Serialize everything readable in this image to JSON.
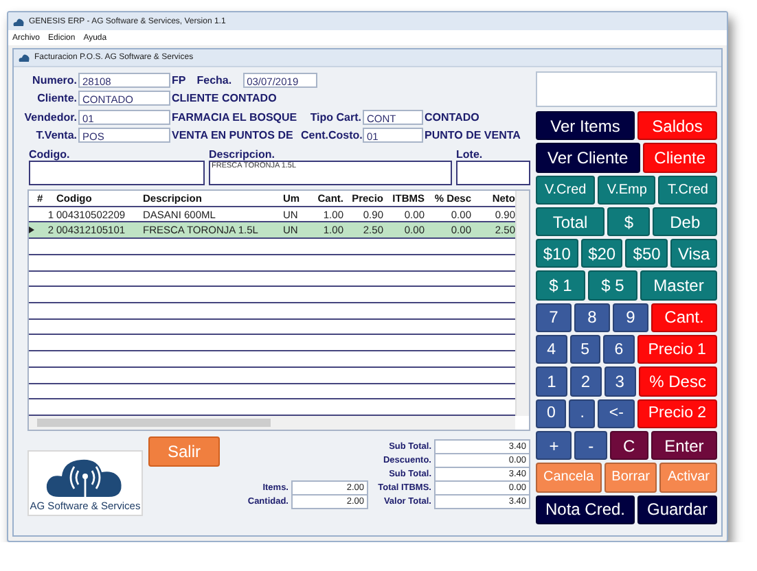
{
  "window": {
    "title": "GENESIS ERP - AG Software & Services, Version 1.1"
  },
  "menu": [
    "Archivo",
    "Edicion",
    "Ayuda"
  ],
  "form_window": {
    "title": "Facturacion P.O.S. AG Software & Services"
  },
  "numero": {
    "label": "Numero.",
    "value": "28108"
  },
  "doc_type": "FP",
  "fecha": {
    "label": "Fecha.",
    "value": "03/07/2019"
  },
  "cliente": {
    "label": "Cliente.",
    "value": "CONTADO",
    "name": "CLIENTE CONTADO"
  },
  "vendedor": {
    "label": "Vendedor.",
    "value": "01",
    "name": "FARMACIA EL BOSQUE"
  },
  "tipo_cart": {
    "label": "Tipo Cart.",
    "value": "CONT",
    "name": "CONTADO"
  },
  "t_venta": {
    "label": "T.Venta.",
    "value": "POS",
    "name": "VENTA EN PUNTOS DE"
  },
  "cent_costo": {
    "label": "Cent.Costo.",
    "value": "01",
    "name": "PUNTO DE VENTA"
  },
  "entry": {
    "codigo": {
      "label": "Codigo."
    },
    "descripcion": {
      "label": "Descripcion.",
      "value": "FRESCA TORONJA 1.5L"
    },
    "lote": {
      "label": "Lote."
    }
  },
  "table": {
    "columns": [
      "#",
      "Codigo",
      "Descripcion",
      "Um",
      "Cant.",
      "Precio",
      "ITBMS",
      "% Desc",
      "Neto"
    ],
    "rows": [
      {
        "selected": false,
        "cells": [
          "1",
          "004310502209",
          "DASANI 600ML",
          "UN",
          "1.00",
          "0.90",
          "0.00",
          "0.00",
          "0.90"
        ]
      },
      {
        "selected": true,
        "cells": [
          "2",
          "004312105101",
          "FRESCA TORONJA 1.5L",
          "UN",
          "1.00",
          "2.50",
          "0.00",
          "0.00",
          "2.50"
        ]
      }
    ]
  },
  "logo": {
    "text": "AG Software & Services"
  },
  "exit_button": "Salir",
  "totals": [
    {
      "label": "Sub Total.",
      "value": "3.40"
    },
    {
      "label": "Descuento.",
      "value": "0.00"
    },
    {
      "label": "Sub Total.",
      "value": "3.40"
    },
    {
      "label": "Total ITBMS.",
      "value": "0.00"
    },
    {
      "label": "Valor Total.",
      "value": "3.40"
    }
  ],
  "counts": [
    {
      "label": "Items.",
      "value": "2.00"
    },
    {
      "label": "Cantidad.",
      "value": "2.00"
    }
  ],
  "keypad": [
    [
      {
        "label": "Ver Items",
        "kind": "navy"
      },
      {
        "label": "Saldos",
        "kind": "red"
      }
    ],
    [
      {
        "label": "Ver Cliente",
        "kind": "navy"
      },
      {
        "label": "Cliente",
        "kind": "red"
      }
    ],
    [
      {
        "label": "V.Cred",
        "kind": "teal"
      },
      {
        "label": "V.Emp",
        "kind": "teal"
      },
      {
        "label": "T.Cred",
        "kind": "teal"
      }
    ],
    [
      {
        "label": "Total",
        "kind": "teal"
      },
      {
        "label": "$",
        "kind": "teal"
      },
      {
        "label": "Deb",
        "kind": "teal"
      }
    ],
    [
      {
        "label": "$10",
        "kind": "teal"
      },
      {
        "label": "$20",
        "kind": "teal"
      },
      {
        "label": "$50",
        "kind": "teal"
      },
      {
        "label": "Visa",
        "kind": "teal"
      }
    ],
    [
      {
        "label": "$ 1",
        "kind": "teal"
      },
      {
        "label": "$ 5",
        "kind": "teal"
      },
      {
        "label": "Master",
        "kind": "teal"
      }
    ],
    [
      {
        "label": "7",
        "kind": "blue"
      },
      {
        "label": "8",
        "kind": "blue"
      },
      {
        "label": "9",
        "kind": "blue"
      },
      {
        "label": "Cant.",
        "kind": "red"
      }
    ],
    [
      {
        "label": "4",
        "kind": "blue"
      },
      {
        "label": "5",
        "kind": "blue"
      },
      {
        "label": "6",
        "kind": "blue"
      },
      {
        "label": "Precio 1",
        "kind": "red"
      }
    ],
    [
      {
        "label": "1",
        "kind": "blue"
      },
      {
        "label": "2",
        "kind": "blue"
      },
      {
        "label": "3",
        "kind": "blue"
      },
      {
        "label": "% Desc",
        "kind": "red"
      }
    ],
    [
      {
        "label": "0",
        "kind": "blue"
      },
      {
        "label": ".",
        "kind": "blue"
      },
      {
        "label": "<-",
        "kind": "blue"
      },
      {
        "label": "Precio 2",
        "kind": "red"
      }
    ],
    [
      {
        "label": "+",
        "kind": "blue"
      },
      {
        "label": "-",
        "kind": "blue"
      },
      {
        "label": "C",
        "kind": "maroon"
      },
      {
        "label": "Enter",
        "kind": "maroon"
      }
    ],
    [
      {
        "label": "Cancela",
        "kind": "orange"
      },
      {
        "label": "Borrar",
        "kind": "orange"
      },
      {
        "label": "Activar",
        "kind": "orange"
      }
    ],
    [
      {
        "label": "Nota Cred.",
        "kind": "navy"
      },
      {
        "label": "Guardar",
        "kind": "navy"
      }
    ]
  ]
}
